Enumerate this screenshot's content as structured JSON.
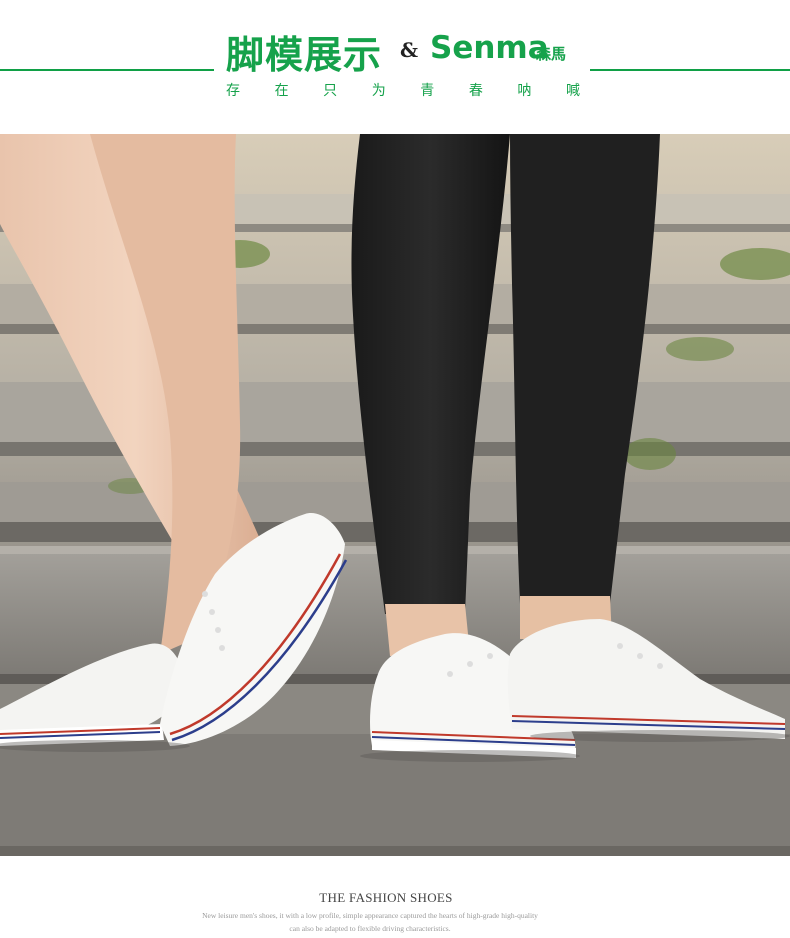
{
  "header": {
    "title_cn": "脚模展示",
    "ampersand": "&",
    "brand_name": "Senma",
    "brand_cn": "森馬",
    "slogan_chars": [
      "存",
      "在",
      "只",
      "为",
      "青",
      "春",
      "呐",
      "喊"
    ],
    "accent_color": "#16a24b"
  },
  "photo": {
    "subject": "shoe-photo"
  },
  "footer": {
    "title": "THE FASHION SHOES",
    "subtitle_line1": "New leisure men's shoes, it with a low profile, simple appearance captured the hearts of high-grade high-quality",
    "subtitle_line2": "can also be adapted to flexible driving characteristics."
  }
}
